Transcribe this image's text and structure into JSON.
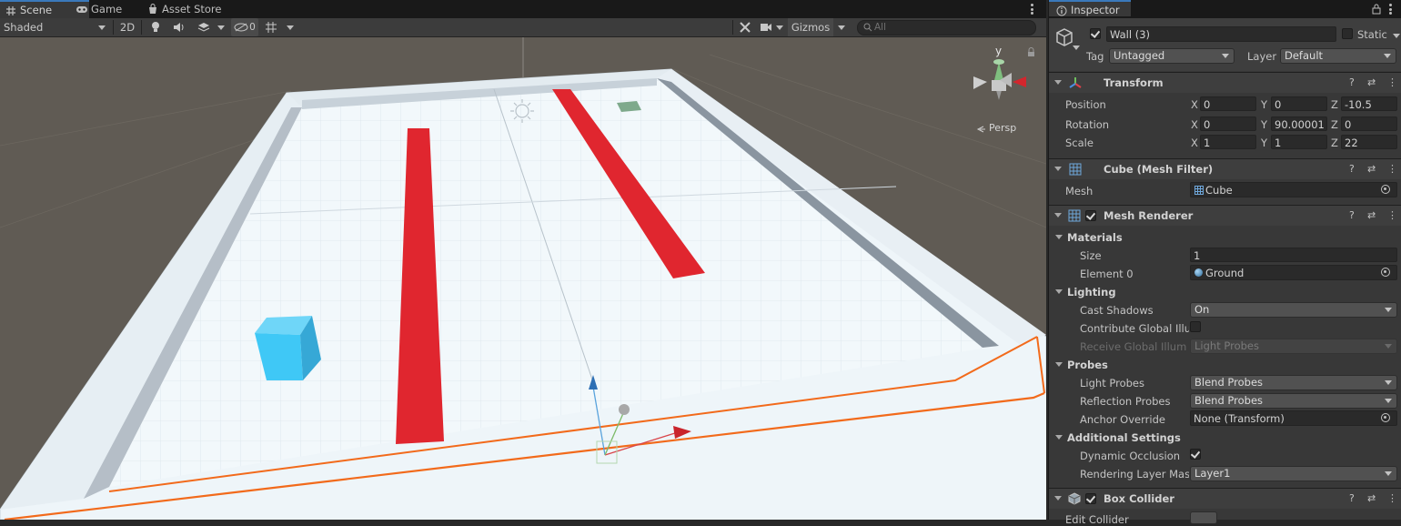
{
  "scene_tabs": {
    "scene": "Scene",
    "game": "Game",
    "asset_store": "Asset Store"
  },
  "scene_toolbar": {
    "draw_mode": "Shaded",
    "mode_2d": "2D",
    "hidden_count": "0",
    "gizmos": "Gizmos",
    "search_placeholder": "All"
  },
  "viewport": {
    "persp_label": "Persp",
    "gizmo_axis_y": "y"
  },
  "inspector": {
    "tab": "Inspector",
    "object_name": "Wall (3)",
    "static_label": "Static",
    "tag_label": "Tag",
    "tag_value": "Untagged",
    "layer_label": "Layer",
    "layer_value": "Default",
    "transform": {
      "title": "Transform",
      "position_label": "Position",
      "rotation_label": "Rotation",
      "scale_label": "Scale",
      "position": {
        "x": "0",
        "y": "0",
        "z": "-10.5"
      },
      "rotation": {
        "x": "0",
        "y": "90.00001",
        "z": "0"
      },
      "scale": {
        "x": "1",
        "y": "1",
        "z": "22"
      }
    },
    "axis_labels": {
      "x": "X",
      "y": "Y",
      "z": "Z"
    },
    "mesh_filter": {
      "title": "Cube (Mesh Filter)",
      "mesh_label": "Mesh",
      "mesh_value": "Cube"
    },
    "mesh_renderer": {
      "title": "Mesh Renderer",
      "materials": "Materials",
      "size_label": "Size",
      "size_value": "1",
      "element0_label": "Element 0",
      "element0_value": "Ground",
      "lighting": "Lighting",
      "cast_shadows_label": "Cast Shadows",
      "cast_shadows_value": "On",
      "contribute_gi_label": "Contribute Global Illu",
      "receive_gi_label": "Receive Global Illum",
      "receive_gi_value": "Light Probes",
      "probes": "Probes",
      "light_probes_label": "Light Probes",
      "light_probes_value": "Blend Probes",
      "reflection_probes_label": "Reflection Probes",
      "reflection_probes_value": "Blend Probes",
      "anchor_override_label": "Anchor Override",
      "anchor_override_value": "None (Transform)",
      "additional_settings": "Additional Settings",
      "dynamic_occlusion_label": "Dynamic Occlusion",
      "rendering_layer_label": "Rendering Layer Mas",
      "rendering_layer_value": "Layer1"
    },
    "box_collider": {
      "title": "Box Collider",
      "edit_collider_label": "Edit Collider"
    }
  },
  "colors": {
    "accent": "#3a79bb",
    "selection_outline": "#f26a1b",
    "red_bar": "#e0262f",
    "cube": "#3fc8f6",
    "floor": "#f0f7fb",
    "wall_shadow": "#8a95a0"
  }
}
